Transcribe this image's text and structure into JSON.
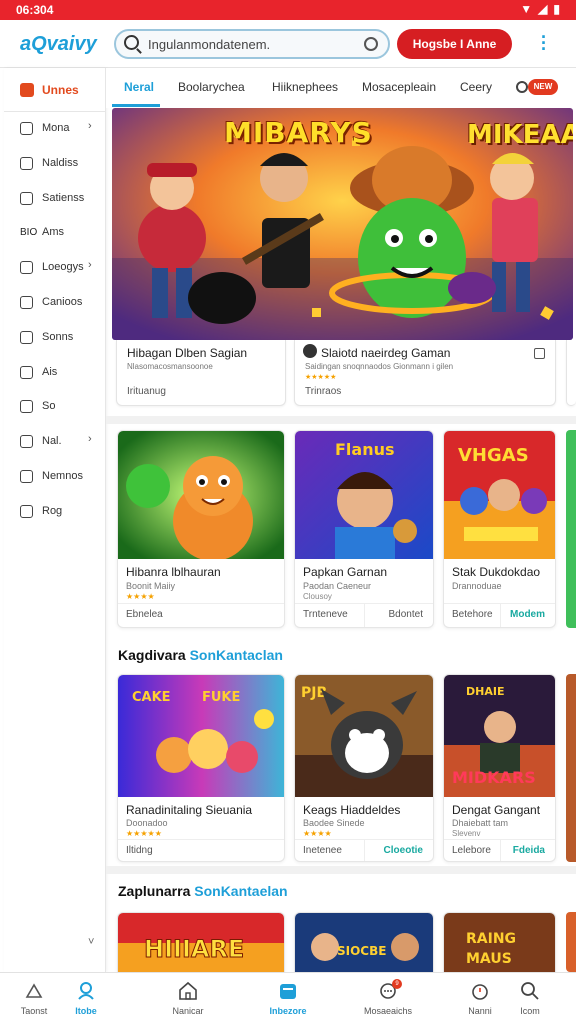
{
  "status_bar": {
    "time": "06:304",
    "icons": "▼◢▮"
  },
  "app_bar": {
    "logo": "aQvaivy",
    "search_placeholder": "Ingulanmondatenem.",
    "cta_label": "Hogsbe I Anne",
    "menu_icon": "kebab-icon"
  },
  "sidebar": {
    "header_label": "Unnes",
    "items": [
      {
        "label": "Mona",
        "icon": "grid-icon",
        "chevron": true
      },
      {
        "label": "Naldiss",
        "icon": "image-icon",
        "chevron": false
      },
      {
        "label": "Satienss",
        "icon": "triangle-icon",
        "chevron": false
      },
      {
        "label": "Ams",
        "icon": "text-icon",
        "chevron": false,
        "prefix": "BIO"
      },
      {
        "label": "Loeogys",
        "icon": "circle-icon",
        "chevron": true
      },
      {
        "label": "Canioos",
        "icon": "doc-icon",
        "chevron": false
      },
      {
        "label": "Sonns",
        "icon": "shield-icon",
        "chevron": false
      },
      {
        "label": "Ais",
        "icon": "panel-icon",
        "chevron": false
      },
      {
        "label": "So",
        "icon": "chat-icon",
        "chevron": false
      },
      {
        "label": "Nal.",
        "icon": "target-icon",
        "chevron": true
      },
      {
        "label": "Nemnos",
        "icon": "list-icon",
        "chevron": false
      },
      {
        "label": "Rog",
        "icon": "smile-icon",
        "chevron": false
      }
    ],
    "footer_chevron": "˅"
  },
  "tabs": {
    "items": [
      "Neral",
      "Boolarychea",
      "Hiiknephees",
      "Mosacepleain",
      "Ceery"
    ],
    "search_badge": "NEW"
  },
  "hero": {
    "title_left": "MIBARYS",
    "title_right": "MIKEAAR"
  },
  "featured": [
    {
      "title": "Hibagan Dlben Sagian",
      "sub": "Nlasomacosmansoonoe",
      "stars": "",
      "footer": "Irituanug"
    },
    {
      "title": "Slaiotd naeirdeg Gaman",
      "sub": "Saidingan snoqnnaodos Gionmann i gilen",
      "stars": "★★★★★",
      "footer": "Trinraos"
    }
  ],
  "grid_row_1": [
    {
      "title": "Hibanra lblhauran",
      "sub": "Boonit Maiiy",
      "stars": "★★★★",
      "b1": "Ebnelea",
      "b2": ""
    },
    {
      "title": "Papkan Garnan",
      "sub": "Paodan Caeneur",
      "stars": "Clousoy",
      "b1": "Trnteneve",
      "b2": "Bdontet"
    },
    {
      "title": "Stak Dukdokdao",
      "sub": "Drannoduae",
      "stars": "",
      "b1": "Betehore",
      "b2": "Modem"
    }
  ],
  "section_2": {
    "title": "Kagdivara",
    "accent": "SonKantaclan"
  },
  "grid_row_2": [
    {
      "title": "Ranadinitaling Sieuania",
      "sub": "Doonadoo",
      "stars": "★★★★★",
      "b1": "Iltidng",
      "b2": ""
    },
    {
      "title": "Keags Hiaddeldes",
      "sub": "Baodee Sinede",
      "stars": "★★★★",
      "b1": "Inetenee",
      "b2": "Cloeotie"
    },
    {
      "title": "Dengat Gangant",
      "sub": "Dhaiebatt tam",
      "stars": "Slevenv",
      "b1": "Lelebore",
      "b2": "Fdeida"
    }
  ],
  "section_3": {
    "title": "Zaplunarra",
    "accent": "SonKantaelan"
  },
  "bottom_nav": [
    {
      "label": "Taonst",
      "icon": "home-outline-icon",
      "active": false
    },
    {
      "label": "Itobe",
      "icon": "person-icon",
      "active": true
    },
    {
      "label": "Nanicar",
      "icon": "house-icon",
      "active": false
    },
    {
      "label": "Inbezore",
      "icon": "store-icon",
      "active": true
    },
    {
      "label": "Mosaeaichs",
      "icon": "chat-bubble-icon",
      "active": false,
      "badge": "9"
    },
    {
      "label": "Nanni",
      "icon": "timer-icon",
      "active": false
    },
    {
      "label": "Icom",
      "icon": "search-icon",
      "active": false
    }
  ]
}
